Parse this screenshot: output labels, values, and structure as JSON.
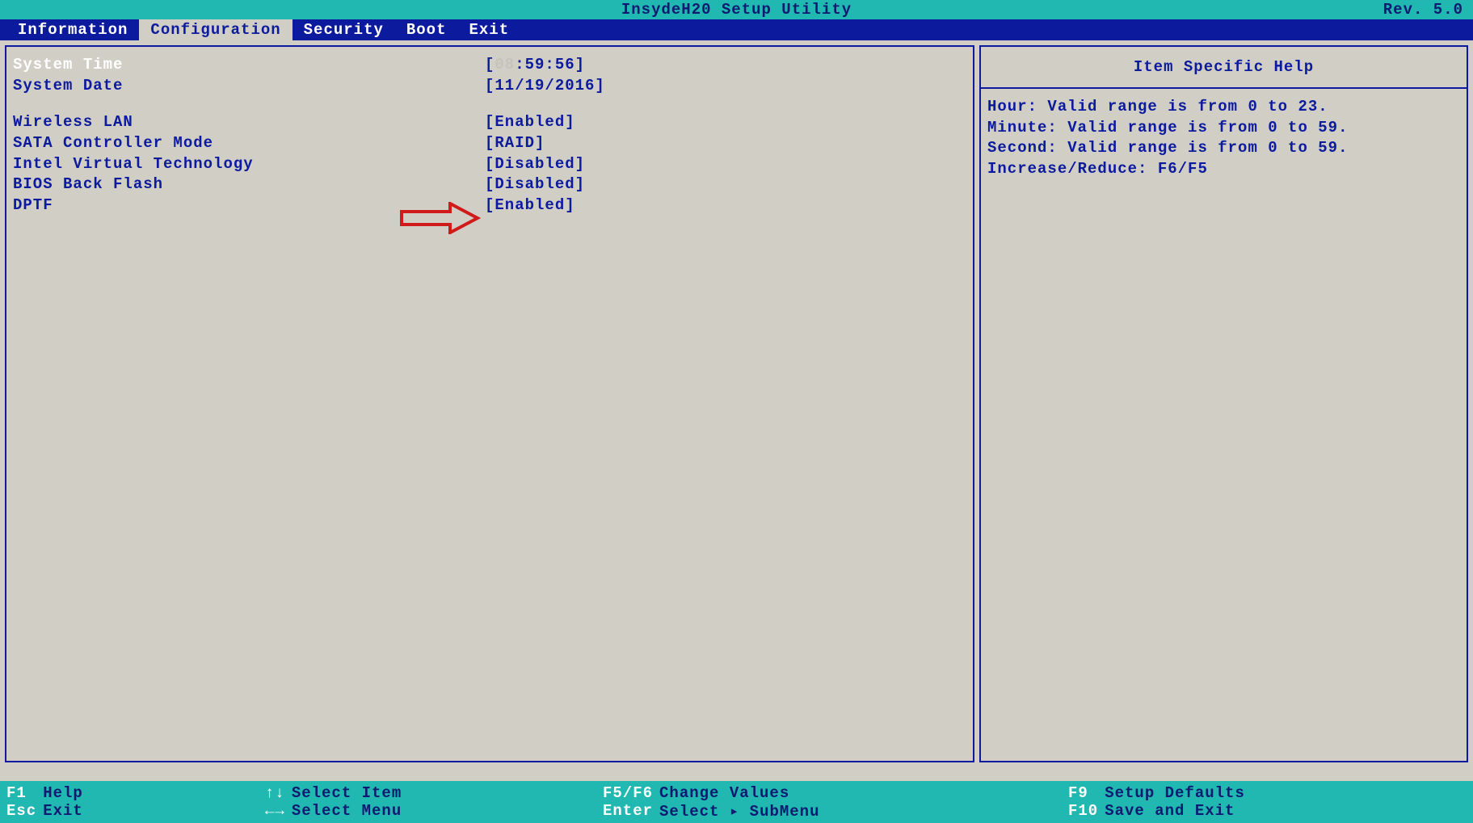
{
  "header": {
    "title": "InsydeH20 Setup Utility",
    "revision": "Rev. 5.0"
  },
  "menu": {
    "items": [
      {
        "label": "Information",
        "active": false
      },
      {
        "label": "Configuration",
        "active": true
      },
      {
        "label": "Security",
        "active": false
      },
      {
        "label": "Boot",
        "active": false
      },
      {
        "label": "Exit",
        "active": false
      }
    ]
  },
  "settings": [
    {
      "label": "System Time",
      "value_prefix": "[",
      "hour": "08",
      "value_rest": ":59:56]",
      "selected": true
    },
    {
      "label": "System Date",
      "value": "[11/19/2016]"
    },
    {
      "spacer": true
    },
    {
      "label": "Wireless LAN",
      "value": "[Enabled]"
    },
    {
      "label": "SATA Controller Mode",
      "value": "[RAID]"
    },
    {
      "label": "Intel Virtual Technology",
      "value": "[Disabled]"
    },
    {
      "label": "BIOS Back Flash",
      "value": "[Disabled]"
    },
    {
      "label": "DPTF",
      "value": "[Enabled]"
    }
  ],
  "help": {
    "title": "Item Specific Help",
    "lines": [
      "Hour: Valid range is from 0 to 23.",
      "Minute: Valid range is from 0 to 59.",
      "Second: Valid range is from 0 to 59.",
      "",
      "Increase/Reduce: F6/F5"
    ]
  },
  "footer": {
    "col1": [
      {
        "key": "F1 ",
        "action": "Help"
      },
      {
        "key": "Esc",
        "action": "Exit"
      }
    ],
    "col2": [
      {
        "key": "↑↓",
        "action": "Select Item"
      },
      {
        "key": "←→",
        "action": "Select Menu"
      }
    ],
    "col3": [
      {
        "key": "F5/F6",
        "action": "Change Values"
      },
      {
        "key": "Enter",
        "action": "Select ▸ SubMenu"
      }
    ],
    "col4": [
      {
        "key": "F9 ",
        "action": "Setup Defaults"
      },
      {
        "key": "F10",
        "action": "Save and Exit"
      }
    ]
  }
}
